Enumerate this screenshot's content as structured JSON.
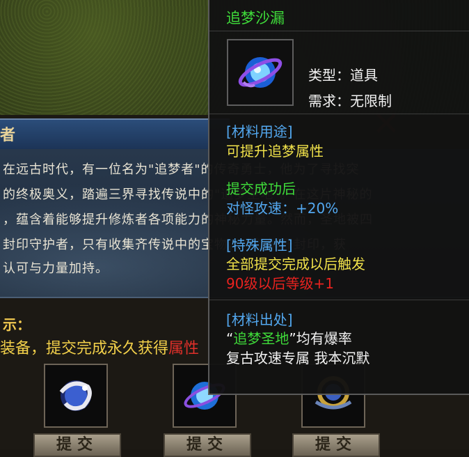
{
  "panel": {
    "title": "者",
    "story": [
      "在远古时代，有一位名为\"追梦者\"的传奇勇士，他为了寻找突",
      "的终极奥义，踏遍三界寻找传说中的\"追梦圣地\"。在这片神秘的",
      "，蕴含着能够提升修炼者各项能力的神秘力量。然而，圣地被四",
      "封印守护者，只有收集齐传说中的宝物，才能解开封印，获",
      "认可与力量加持。"
    ],
    "hint_label": "示：",
    "reward_text": "装备，提交完成永久获得",
    "reward_red": "属性",
    "submit_label": "提交"
  },
  "tooltip": {
    "item_name": "追梦沙漏",
    "type_line": "类型：道具",
    "req_line": "需求：无限制",
    "material_use_label": "[材料用途]",
    "material_use_text": "可提升追梦属性",
    "submit_success_label": "提交成功后",
    "submit_success_text": "对怪攻速：+20%",
    "special_label": "[特殊属性]",
    "special_text": "全部提交完成以后触发",
    "special_red": "90级以后等级+1",
    "source_label": "[材料出处]",
    "source_quote_open": "“",
    "source_place": "追梦圣地",
    "source_quote_rest": "”均有爆率",
    "source_line2": "复古攻速专属 我本沉默"
  },
  "icons": [
    "hourglass-orb-icon",
    "dragon-orb-icon",
    "blue-orb-icon",
    "gear-ring-icon"
  ],
  "colors": {
    "item_name": "#3fdc3a",
    "label_blue": "#53a8f0",
    "value_yellow": "#f0e14a",
    "value_red": "#e8221f"
  }
}
